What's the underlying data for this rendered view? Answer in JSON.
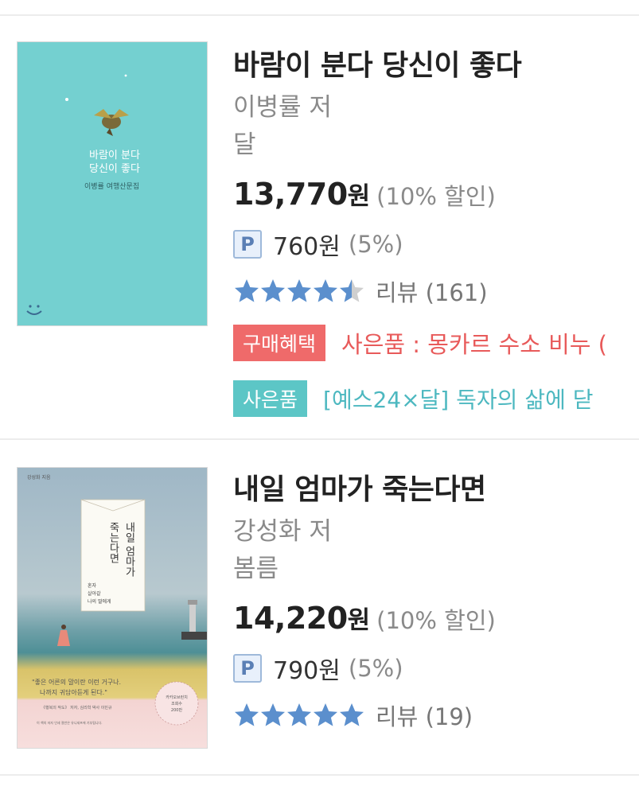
{
  "books": [
    {
      "title": "바람이 분다 당신이 좋다",
      "author": "이병률 저",
      "publisher": "달",
      "price": "13,770",
      "currency": "원",
      "discount": "(10% 할인)",
      "point_badge": "P",
      "point": "760원",
      "point_rate": "(5%)",
      "rating": 4.5,
      "review": "리뷰 (161)",
      "benefit_badge": "구매혜택",
      "benefit_text": "사은품 : 몽카르 수소 비누 (",
      "gift_badge": "사은품",
      "gift_text": "[예스24×달] 독자의 삶에 닫",
      "cover": {
        "bg": "#74d0d0",
        "title_lines": [
          "바람이 분다",
          "당신이 좋다"
        ],
        "subtitle": "이병률 여행산문집"
      }
    },
    {
      "title": "내일 엄마가 죽는다면",
      "author": "강성화 저",
      "publisher": "봄름",
      "price": "14,220",
      "currency": "원",
      "discount": "(10% 할인)",
      "point_badge": "P",
      "point": "790원",
      "point_rate": "(5%)",
      "rating": 5,
      "review": "리뷰 (19)",
      "cover": {
        "author_label": "강성화 지음",
        "title_col_right": "내일 엄마가",
        "title_col_left": "죽는다면",
        "sub_lines": [
          "혼자",
          "살아갈",
          "나의 딸에게"
        ],
        "quote_lines": [
          "\"좋은 어른의 말이란 이런 거구나.",
          "나까지 귀담아듣게 된다.\""
        ],
        "quote_source": "《행복의 작도》 저자, 심리학 박사 이민규",
        "note": "이 책의 저자 인세 절반은 유니세프에 기부됩니다.",
        "seal_lines": [
          "카카오브런치",
          "조회수",
          "200만"
        ]
      }
    }
  ],
  "colors": {
    "star": "#5b8fcd",
    "star_empty": "#cfcfcf",
    "benefit": "#ef6a6a",
    "gift": "#5cc6c6"
  }
}
